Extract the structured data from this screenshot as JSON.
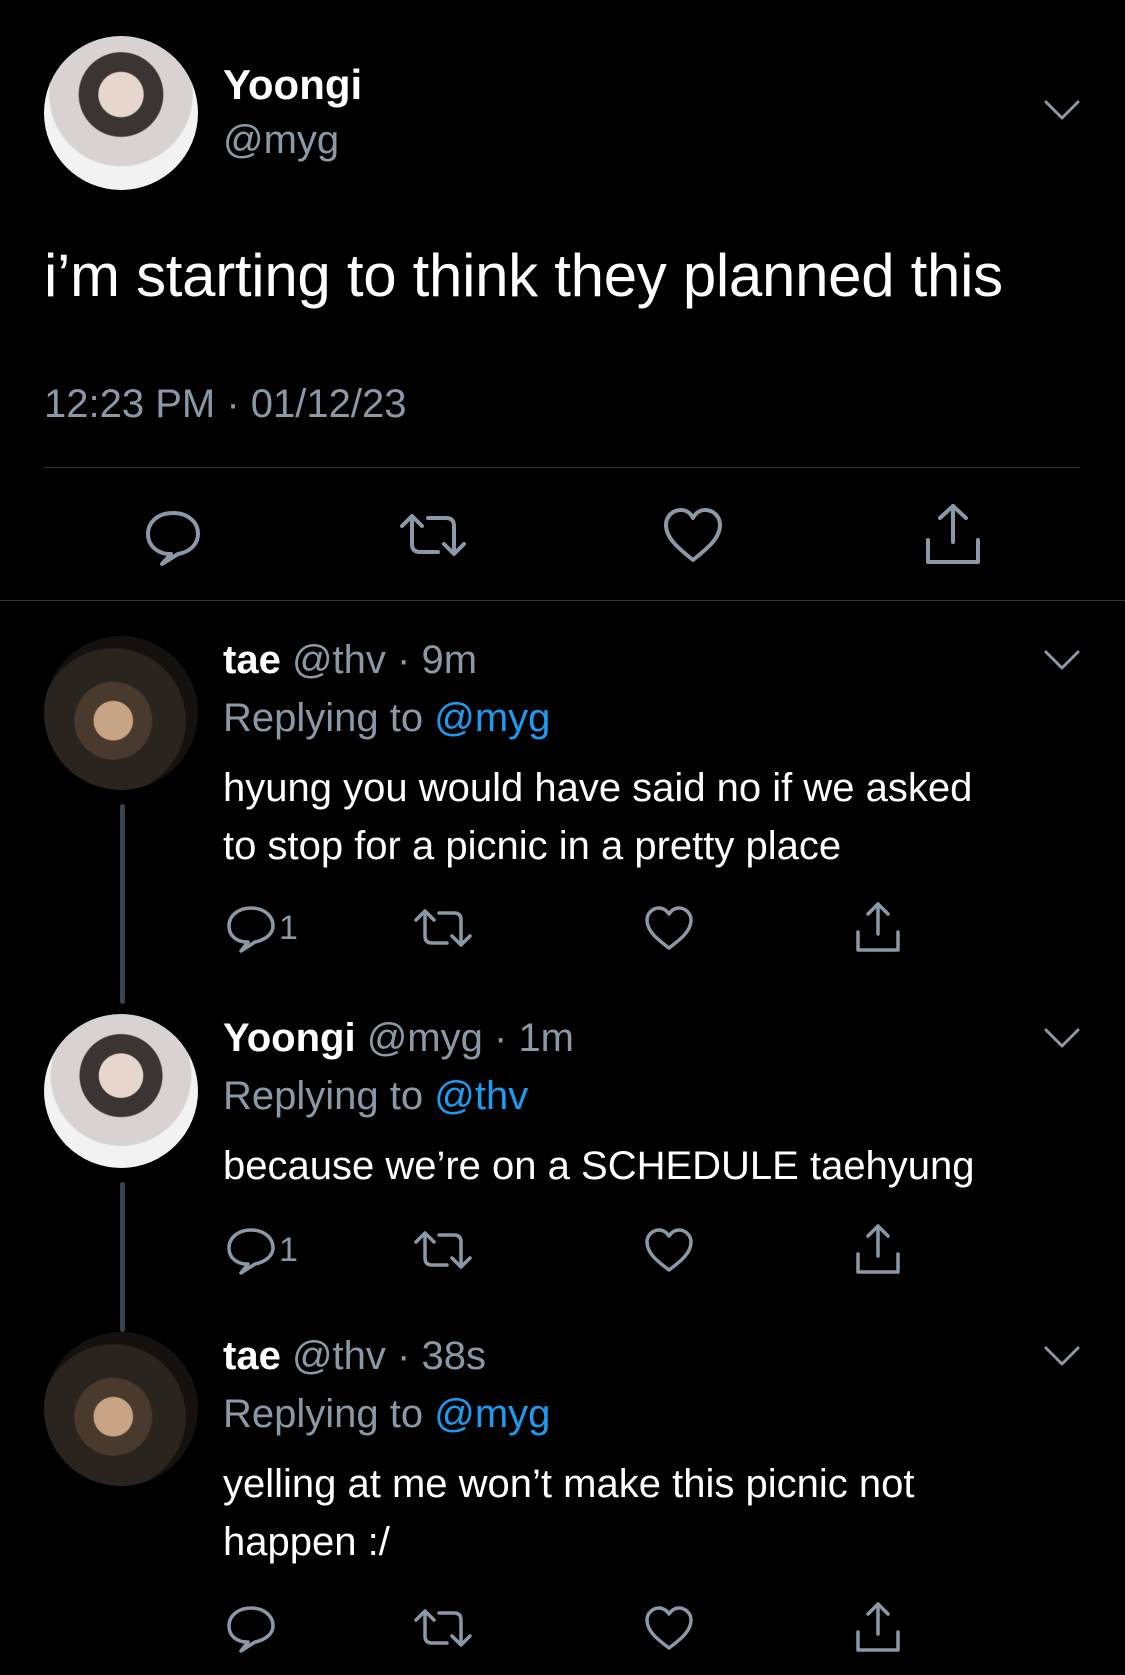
{
  "main_tweet": {
    "display_name": "Yoongi",
    "handle": "@myg",
    "text": "i’m starting to think they planned this",
    "timestamp": "12:23 PM · 01/12/23",
    "actions": [
      "reply-icon",
      "retweet-icon",
      "like-icon",
      "share-icon"
    ]
  },
  "replies": [
    {
      "display_name": "tae",
      "handle": "@thv",
      "dot": "·",
      "time": "9m",
      "replying_prefix": "Replying to ",
      "replying_to": "@myg",
      "text_line1": "hyung you would have said no if we asked",
      "text_line2": "to stop for a picnic in a pretty place",
      "reply_count": "1"
    },
    {
      "display_name": "Yoongi",
      "handle": "@myg",
      "dot": "·",
      "time": "1m",
      "replying_prefix": "Replying to ",
      "replying_to": "@thv",
      "text_line1": "because we’re on a SCHEDULE taehyung",
      "reply_count": "1"
    },
    {
      "display_name": "tae",
      "handle": "@thv",
      "dot": "·",
      "time": "38s",
      "replying_prefix": "Replying to ",
      "replying_to": "@myg",
      "text_line1": "yelling at me won’t make this picnic not",
      "text_line2": "happen :/"
    }
  ],
  "colors": {
    "background": "#000000",
    "text": "#ffffff",
    "secondary": "#8b98a5",
    "link": "#1d9bf0",
    "divider": "#2f3336"
  }
}
